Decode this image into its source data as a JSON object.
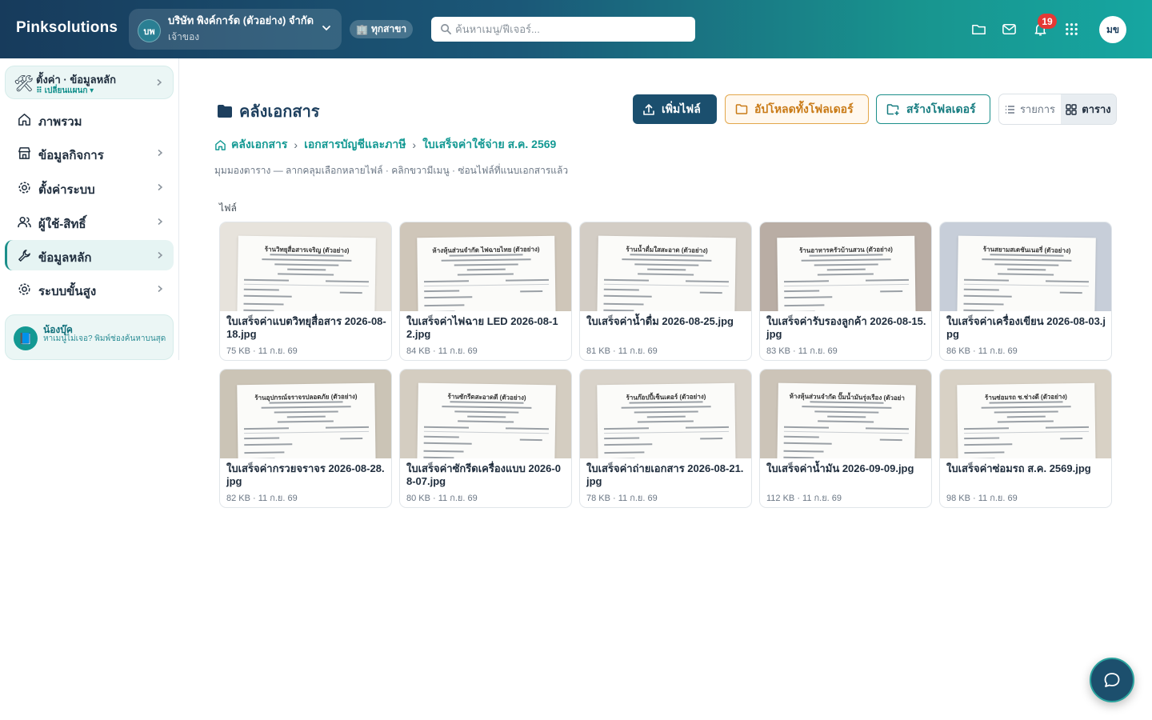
{
  "app": {
    "brand": "Pinksolutions"
  },
  "company": {
    "initials": "บพ",
    "name": "บริษัท พิงค์การ์ด (ตัวอย่าง) จำกัด",
    "role": "เจ้าของ"
  },
  "branch": {
    "icon": "🏢",
    "label": "ทุกสาขา"
  },
  "search": {
    "placeholder": "ค้นหาเมนู/ฟีเจอร์..."
  },
  "header": {
    "notifications": "19",
    "avatar": "มข"
  },
  "sidebar": {
    "settings_card": {
      "title": "ตั้งค่า · ข้อมูลหลัก",
      "subtitle": "⠿ เปลี่ยนแผนก ▾"
    },
    "items": [
      {
        "label": "ภาพรวม",
        "icon": "home-icon"
      },
      {
        "label": "ข้อมูลกิจการ",
        "icon": "store-icon"
      },
      {
        "label": "ตั้งค่าระบบ",
        "icon": "gear-icon"
      },
      {
        "label": "ผู้ใช้-สิทธิ์",
        "icon": "users-icon"
      },
      {
        "label": "ข้อมูลหลัก",
        "icon": "wrench-icon"
      },
      {
        "label": "ระบบขั้นสูง",
        "icon": "gear-icon"
      }
    ],
    "helper": {
      "title": "น้องบุ๊ค",
      "subtitle": "หาเมนูไม่เจอ? พิมพ์ช่องค้นหาบนสุด"
    }
  },
  "main": {
    "title": "คลังเอกสาร",
    "buttons": {
      "add_file": "เพิ่มไฟล์",
      "upload_folder": "อัปโหลดทั้งโฟลเดอร์",
      "create_folder": "สร้างโฟลเดอร์"
    },
    "view": {
      "list": "รายการ",
      "grid": "ตาราง"
    },
    "breadcrumb": [
      "คลังเอกสาร",
      "เอกสารบัญชีและภาษี",
      "ใบเสร็จค่าใช้จ่าย ส.ค. 2569"
    ],
    "hint": "มุมมองตาราง — ลากคลุมเลือกหลายไฟล์ · คลิกขวามีเมนู · ซ่อนไฟล์ที่แนบเอกสารแล้ว",
    "section": "ไฟล์",
    "files": [
      {
        "name": "ใบเสร็จค่าแบตวิทยุสื่อสาร 2026-08-18.jpg",
        "meta": "75 KB · 11 ก.ย. 69",
        "shop": "ร้านวิทยุสื่อสารเจริญ (ตัวอย่าง)",
        "bg": "#e7e3dc"
      },
      {
        "name": "ใบเสร็จค่าไฟฉาย LED 2026-08-12.jpg",
        "meta": "84 KB · 11 ก.ย. 69",
        "shop": "ห้างหุ้นส่วนจำกัด ไฟฉายไทย (ตัวอย่าง)",
        "bg": "#cfc6b9"
      },
      {
        "name": "ใบเสร็จค่าน้ำดื่ม 2026-08-25.jpg",
        "meta": "81 KB · 11 ก.ย. 69",
        "shop": "ร้านน้ำดื่มใสสะอาด (ตัวอย่าง)",
        "bg": "#d3cdc5"
      },
      {
        "name": "ใบเสร็จค่ารับรองลูกค้า 2026-08-15.jpg",
        "meta": "83 KB · 11 ก.ย. 69",
        "shop": "ร้านอาหารครัวบ้านสวน (ตัวอย่าง)",
        "bg": "#b9ada4"
      },
      {
        "name": "ใบเสร็จค่าเครื่องเขียน 2026-08-03.jpg",
        "meta": "86 KB · 11 ก.ย. 69",
        "shop": "ร้านสยามสเตชันเนอรี่ (ตัวอย่าง)",
        "bg": "#c7ced9"
      },
      {
        "name": "ใบเสร็จค่ากรวยจราจร 2026-08-28.jpg",
        "meta": "82 KB · 11 ก.ย. 69",
        "shop": "ร้านอุปกรณ์จราจรปลอดภัย (ตัวอย่าง)",
        "bg": "#cbc4b6"
      },
      {
        "name": "ใบเสร็จค่าซักรีดเครื่องแบบ 2026-08-07.jpg",
        "meta": "80 KB · 11 ก.ย. 69",
        "shop": "ร้านซักรีดสะอาดดี (ตัวอย่าง)",
        "bg": "#d4cdc1"
      },
      {
        "name": "ใบเสร็จค่าถ่ายเอกสาร 2026-08-21.jpg",
        "meta": "78 KB · 11 ก.ย. 69",
        "shop": "ร้านก๊อปปี้เซ็นเตอร์ (ตัวอย่าง)",
        "bg": "#d9d3ca"
      },
      {
        "name": "ใบเสร็จค่าน้ำมัน 2026-09-09.jpg",
        "meta": "112 KB · 11 ก.ย. 69",
        "shop": "ห้างหุ้นส่วนจำกัด ปั๊มน้ำมันรุ่งเรือง (ตัวอย่าง)",
        "bg": "#ccc4b8"
      },
      {
        "name": "ใบเสร็จค่าซ่อมรถ ส.ค. 2569.jpg",
        "meta": "98 KB · 11 ก.ย. 69",
        "shop": "ร้านซ่อมรถ ช.ช่างดี (ตัวอย่าง)",
        "bg": "#d8d1c5"
      }
    ]
  },
  "colors": {
    "primary": "#1b4f6e",
    "accent": "#139993",
    "orange": "#c97a16",
    "badge": "#e53935"
  }
}
